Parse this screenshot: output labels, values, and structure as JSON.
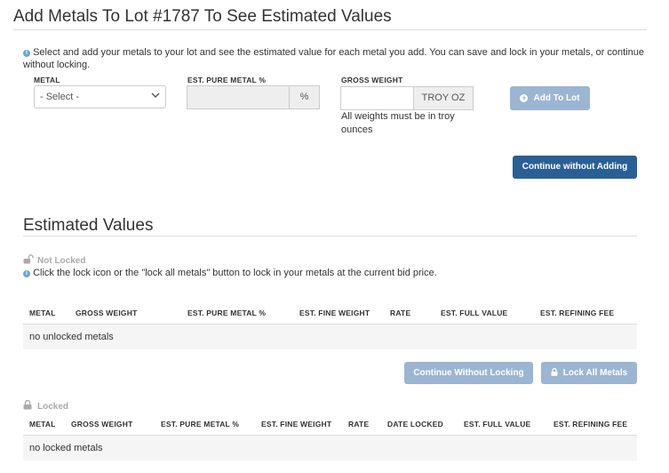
{
  "header": {
    "title": "Add Metals To Lot #1787 To See Estimated Values"
  },
  "intro": {
    "text": "Select and add your metals to your lot and see the estimated value for each metal you add. You can save and lock in your metals, or continue without locking."
  },
  "form": {
    "metal_label": "METAL",
    "metal_selected": "- Select -",
    "pure_label": "EST. PURE METAL %",
    "pure_value": "",
    "pure_addon": "%",
    "weight_label": "GROSS WEIGHT",
    "weight_value": "",
    "weight_addon": "TROY OZ",
    "weight_help": "All weights must be in troy ounces",
    "add_button": "Add To Lot",
    "continue_button": "Continue without Adding"
  },
  "estimated": {
    "title": "Estimated Values",
    "not_locked_label": "Not Locked",
    "note": "Click the lock icon or the \"lock all metals\" button to lock in your metals at the current bid price.",
    "unlocked_columns": [
      "METAL",
      "GROSS WEIGHT",
      "EST. PURE METAL %",
      "EST. FINE WEIGHT",
      "RATE",
      "EST. FULL VALUE",
      "EST. REFINING FEE"
    ],
    "unlocked_empty": "no unlocked metals",
    "continue_without_locking": "Continue Without Locking",
    "lock_all": "Lock All Metals",
    "locked_label": "Locked",
    "locked_columns": [
      "METAL",
      "GROSS WEIGHT",
      "EST. PURE METAL %",
      "EST. FINE WEIGHT",
      "RATE",
      "DATE LOCKED",
      "EST. FULL VALUE",
      "EST. REFINING FEE"
    ],
    "locked_empty": "no locked metals"
  },
  "colors": {
    "primary": "#2a5f95",
    "primary_disabled": "#9bb5d3",
    "info": "#6aa6d6"
  },
  "icons": {
    "info": "info-circle-icon",
    "unlock": "unlock-icon",
    "lock": "lock-icon",
    "plus": "plus-circle-icon",
    "chevron": "chevron-down-icon"
  }
}
